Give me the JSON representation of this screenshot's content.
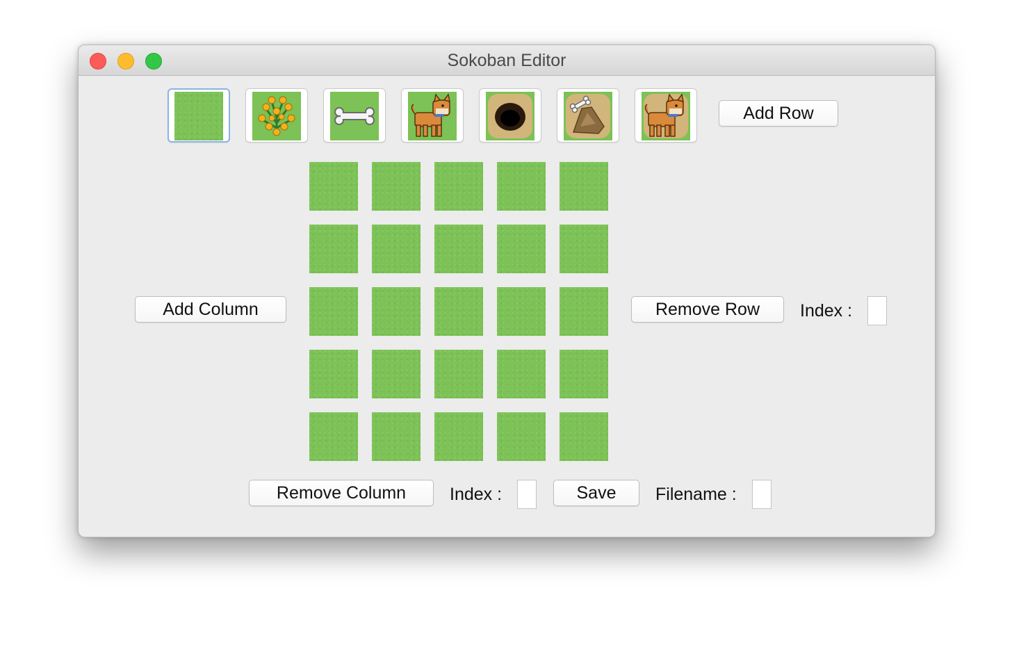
{
  "window": {
    "title": "Sokoban Editor"
  },
  "palette": {
    "tiles": [
      {
        "name": "grass-tile",
        "selected": true
      },
      {
        "name": "bush-tile",
        "selected": false
      },
      {
        "name": "bone-tile",
        "selected": false
      },
      {
        "name": "dog-tile",
        "selected": false
      },
      {
        "name": "hole-tile",
        "selected": false
      },
      {
        "name": "bone-in-hole-tile",
        "selected": false
      },
      {
        "name": "dog-on-hole-tile",
        "selected": false
      }
    ],
    "add_row_label": "Add Row"
  },
  "grid": {
    "rows": 5,
    "cols": 5,
    "tile": "grass"
  },
  "controls": {
    "add_column_label": "Add Column",
    "remove_row_label": "Remove Row",
    "row_index_label": "Index :",
    "remove_column_label": "Remove Column",
    "column_index_label": "Index :",
    "save_label": "Save",
    "filename_label": "Filename :"
  },
  "colors": {
    "grass": "#7cc256",
    "sand": "#d2b57a",
    "selection": "#8ab3e6"
  }
}
